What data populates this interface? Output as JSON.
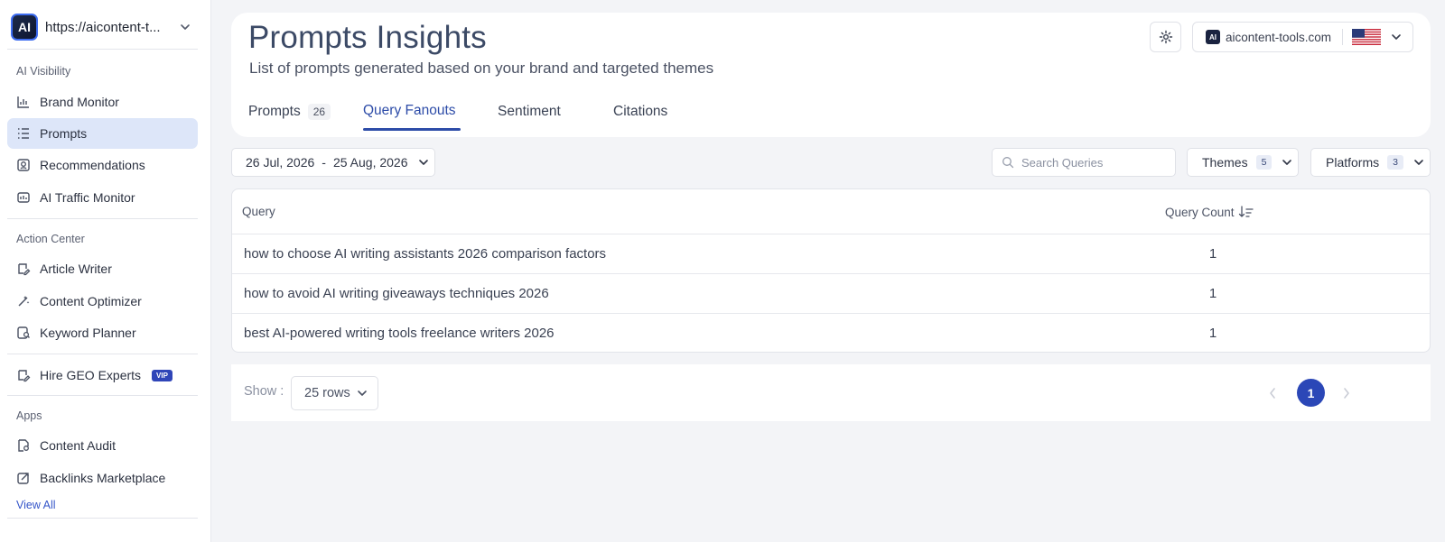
{
  "workspace": {
    "logo_text": "AI",
    "name": "https://aicontent-t..."
  },
  "sidebar": {
    "sections": [
      {
        "label": "AI Visibility"
      },
      {
        "label": "Action Center"
      },
      {
        "label": "Apps"
      }
    ],
    "items": [
      {
        "label": "Brand Monitor",
        "icon": "bar-chart-icon",
        "active": false
      },
      {
        "label": "Prompts",
        "icon": "list-icon",
        "active": true
      },
      {
        "label": "Recommendations",
        "icon": "recommendations-icon",
        "active": false
      },
      {
        "label": "AI Traffic Monitor",
        "icon": "traffic-monitor-icon",
        "active": false
      },
      {
        "label": "Article Writer",
        "icon": "article-writer-icon",
        "active": false
      },
      {
        "label": "Content Optimizer",
        "icon": "magic-wand-icon",
        "active": false
      },
      {
        "label": "Keyword Planner",
        "icon": "keyword-planner-icon",
        "active": false
      },
      {
        "label": "Hire GEO Experts",
        "icon": "hire-experts-icon",
        "active": false,
        "badge": "VIP"
      },
      {
        "label": "Content Audit",
        "icon": "content-audit-icon",
        "active": false
      },
      {
        "label": "Backlinks Marketplace",
        "icon": "backlinks-icon",
        "active": false
      }
    ],
    "view_all": "View All"
  },
  "header": {
    "title": "Prompts Insights",
    "subtitle": "List of prompts generated based on your brand and targeted themes",
    "domain": "aicontent-tools.com",
    "domain_logo_text": "AI",
    "country": "US"
  },
  "tabs": [
    {
      "label": "Prompts",
      "count": "26",
      "active": false
    },
    {
      "label": "Query Fanouts",
      "active": true
    },
    {
      "label": "Sentiment",
      "active": false
    },
    {
      "label": "Citations",
      "active": false
    }
  ],
  "filters": {
    "date_start": "26 Jul, 2026",
    "date_sep": "-",
    "date_end": "25 Aug, 2026",
    "search_placeholder": "Search Queries",
    "themes_label": "Themes",
    "themes_count": "5",
    "platforms_label": "Platforms",
    "platforms_count": "3"
  },
  "table": {
    "columns": {
      "query": "Query",
      "count": "Query Count"
    },
    "rows": [
      {
        "query": "how to choose AI writing assistants 2026 comparison factors",
        "count": "1"
      },
      {
        "query": "how to avoid AI writing giveaways techniques 2026",
        "count": "1"
      },
      {
        "query": "best AI-powered writing tools freelance writers 2026",
        "count": "1"
      }
    ]
  },
  "pagination": {
    "show_label": "Show :",
    "rows_option": "25 rows",
    "current_page": "1"
  },
  "colors": {
    "accent": "#2b47b7",
    "active_nav_bg": "#dde6f9",
    "page_bg": "#f3f4f7"
  }
}
